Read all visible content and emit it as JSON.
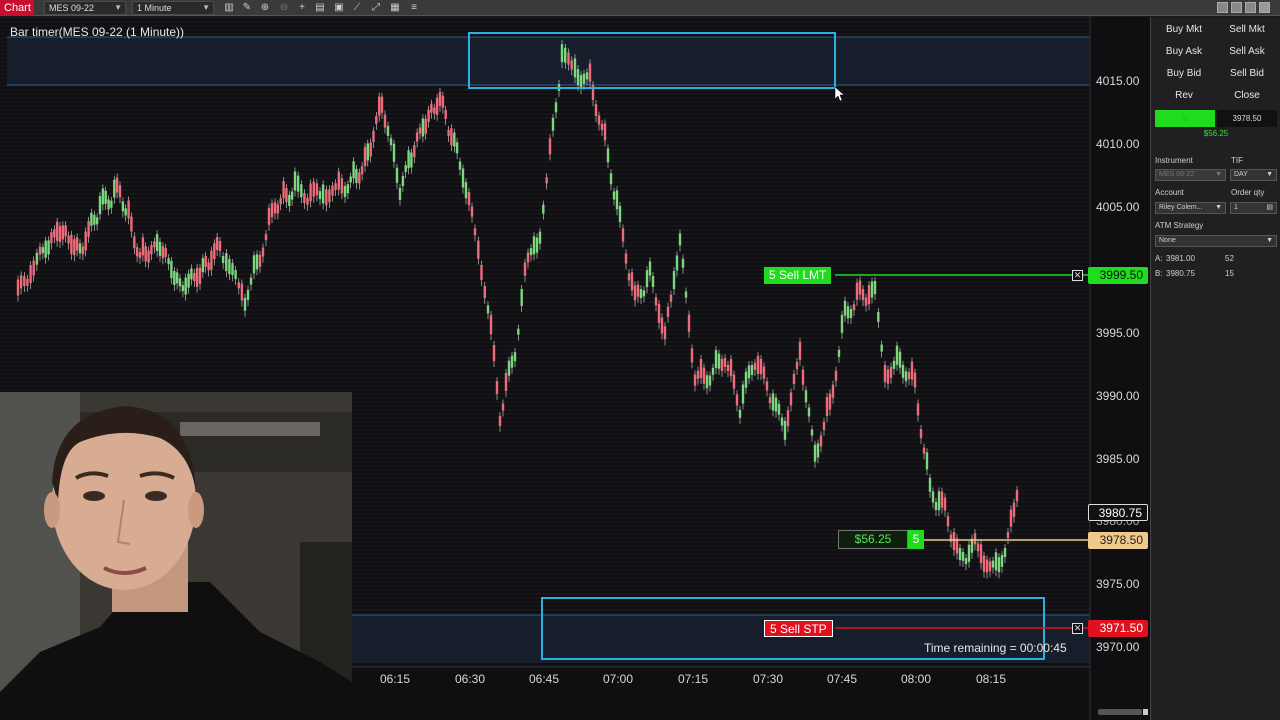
{
  "toolbar": {
    "tab_label": "Chart",
    "instrument": "MES 09-22",
    "interval": "1 Minute",
    "icons": [
      "bar-style-icon",
      "draw-icon",
      "zoom-icon",
      "zoom-out-icon",
      "crosshair-icon",
      "properties-icon",
      "template-icon",
      "indicators-icon",
      "strategies-icon",
      "data-box-icon",
      "list-icon"
    ]
  },
  "chart": {
    "title": "Bar timer(MES 09-22 (1 Minute))",
    "time_remaining": "Time remaining = 00:00:45",
    "y_ticks": [
      "4015.00",
      "4010.00",
      "4005.00",
      "3995.00",
      "3990.00",
      "3985.00",
      "3980.00",
      "3975.00",
      "3970.00"
    ],
    "x_ticks": [
      "06:15",
      "06:30",
      "06:45",
      "07:00",
      "07:15",
      "07:30",
      "07:45",
      "08:00",
      "08:15"
    ],
    "price_last": "3980.75",
    "sell_limit": {
      "label": "5 Sell LMT",
      "price": "3999.50",
      "color": "#1fdc1f"
    },
    "sell_stop": {
      "label": "5 Sell STP",
      "price": "3971.50",
      "color": "#e0101e"
    },
    "position": {
      "pnl": "$56.25",
      "qty": "5",
      "avg_price": "3978.50",
      "color": "#f0c88a"
    },
    "colors": {
      "up": "#7cd87c",
      "down": "#f06a7a",
      "highlight_box": "#2bb0e0"
    }
  },
  "order_panel": {
    "buttons": {
      "buy_mkt": "Buy Mkt",
      "sell_mkt": "Sell Mkt",
      "buy_ask": "Buy Ask",
      "sell_ask": "Sell Ask",
      "buy_bid": "Buy Bid",
      "sell_bid": "Sell Bid",
      "rev": "Rev",
      "close": "Close"
    },
    "position_qty": "5",
    "position_price": "3978.50",
    "unrealized": "$56.25",
    "instrument_label": "Instrument",
    "instrument_value": "MES 09-22",
    "tif_label": "TIF",
    "tif_value": "DAY",
    "account_label": "Account",
    "account_value": "Riley Colem...",
    "order_qty_label": "Order qty",
    "order_qty_value": "1",
    "atm_label": "ATM Strategy",
    "atm_value": "None",
    "ask_label": "A:",
    "ask_price": "3981.00",
    "ask_size": "52",
    "bid_label": "B:",
    "bid_price": "3980.75",
    "bid_size": "15"
  }
}
